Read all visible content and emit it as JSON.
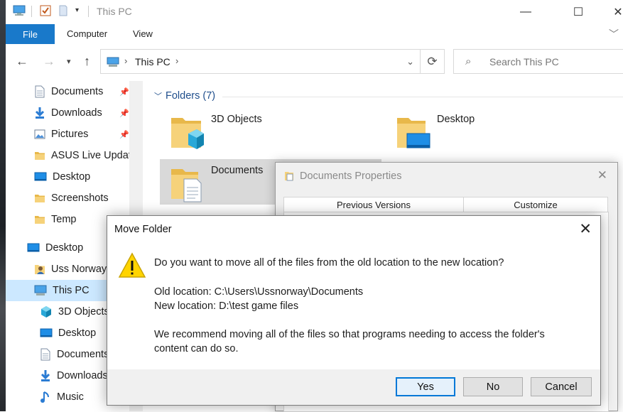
{
  "window": {
    "title": "This PC",
    "minimize_glyph": "—",
    "maximize_glyph": "☐",
    "close_glyph": "✕"
  },
  "ribbon": {
    "tabs": [
      "File",
      "Computer",
      "View"
    ]
  },
  "address": {
    "location": "This PC",
    "search_placeholder": "Search This PC"
  },
  "navpane": {
    "items": [
      {
        "label": "Documents",
        "icon": "documents-icon",
        "pinned": true
      },
      {
        "label": "Downloads",
        "icon": "downloads-icon",
        "pinned": true
      },
      {
        "label": "Pictures",
        "icon": "pictures-icon",
        "pinned": true
      },
      {
        "label": "ASUS Live Updat",
        "icon": "folder-icon",
        "pinned": false
      },
      {
        "label": "Desktop",
        "icon": "desktop-icon",
        "pinned": false
      },
      {
        "label": "Screenshots",
        "icon": "folder-icon",
        "pinned": false
      },
      {
        "label": "Temp",
        "icon": "folder-icon",
        "pinned": false
      },
      {
        "label": "Desktop",
        "icon": "desktop-icon",
        "pinned": false
      },
      {
        "label": "Uss Norway",
        "icon": "user-folder-icon",
        "pinned": false
      },
      {
        "label": "This PC",
        "icon": "this-pc-icon",
        "pinned": false,
        "selected": true
      },
      {
        "label": "3D Objects",
        "icon": "3d-objects-icon",
        "pinned": false
      },
      {
        "label": "Desktop",
        "icon": "desktop-icon",
        "pinned": false
      },
      {
        "label": "Documents",
        "icon": "documents-icon",
        "pinned": false
      },
      {
        "label": "Downloads",
        "icon": "downloads-icon",
        "pinned": false
      },
      {
        "label": "Music",
        "icon": "music-icon",
        "pinned": false
      }
    ]
  },
  "content": {
    "group_title": "Folders (7)",
    "folders": [
      {
        "name": "3D Objects"
      },
      {
        "name": "Desktop"
      },
      {
        "name": "Documents"
      }
    ]
  },
  "properties": {
    "title": "Documents Properties",
    "tabs": [
      "Previous Versions",
      "Customize"
    ]
  },
  "move_dialog": {
    "title": "Move Folder",
    "question": "Do you want to move all of the files from the old location to the new location?",
    "old_location": "Old location: C:\\Users\\Ussnorway\\Documents",
    "new_location": "New location: D:\\test game files",
    "recommendation_line1": "We recommend moving all of the files so that programs needing to access the folder's",
    "recommendation_line2": "content can do so.",
    "buttons": {
      "yes": "Yes",
      "no": "No",
      "cancel": "Cancel"
    }
  },
  "colors": {
    "accent": "#1979ca",
    "selection": "#cce8ff",
    "folder_yellow": "#f2c94c",
    "warning_yellow": "#ffd400"
  }
}
